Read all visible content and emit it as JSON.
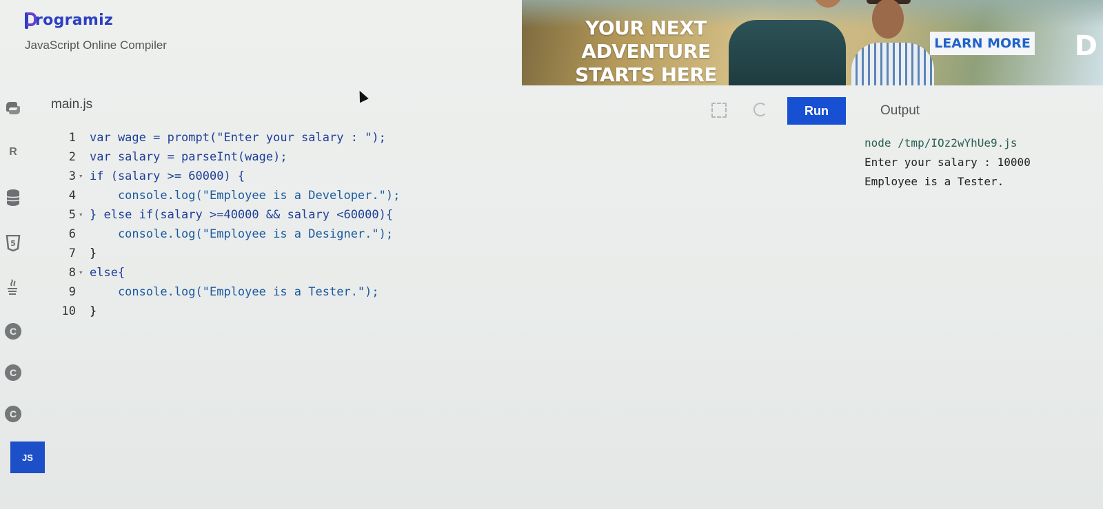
{
  "brand": {
    "logo_text": "rogramiz",
    "subtitle": "JavaScript Online Compiler"
  },
  "ad": {
    "headline_line1": "YOUR NEXT ADVENTURE",
    "headline_line2": "STARTS HERE",
    "cta_label": "LEARN MORE",
    "partial_text": "D"
  },
  "sidebar": {
    "icons": [
      "python-icon",
      "r-icon",
      "database-icon",
      "html5-icon",
      "java-icon",
      "c-icon",
      "cpp-icon",
      "csharp-icon"
    ],
    "c_glyph": "C",
    "r_glyph": "R",
    "html_glyph": "5",
    "active_label": "JS"
  },
  "editor": {
    "file_name": "main.js",
    "lines": [
      {
        "num": "1",
        "fold": "",
        "text": "var wage = prompt(\"Enter your salary : \");"
      },
      {
        "num": "2",
        "fold": "",
        "text": "var salary = parseInt(wage);"
      },
      {
        "num": "3",
        "fold": "▾",
        "text": "if (salary >= 60000) {"
      },
      {
        "num": "4",
        "fold": "",
        "text": "    console.log(\"Employee is a Developer.\");"
      },
      {
        "num": "5",
        "fold": "▾",
        "text": "} else if(salary >=40000 && salary <60000){"
      },
      {
        "num": "6",
        "fold": "",
        "text": "    console.log(\"Employee is a Designer.\");"
      },
      {
        "num": "7",
        "fold": "",
        "text": "}"
      },
      {
        "num": "8",
        "fold": "▾",
        "text": "else{"
      },
      {
        "num": "9",
        "fold": "",
        "text": "    console.log(\"Employee is a Tester.\");"
      },
      {
        "num": "10",
        "fold": "",
        "text": "}"
      }
    ]
  },
  "toolbar": {
    "run_label": "Run",
    "output_label": "Output"
  },
  "output": {
    "lines": [
      "node /tmp/IOz2wYhUe9.js",
      "Enter your salary : 10000",
      "Employee is a Tester."
    ]
  },
  "colors": {
    "accent": "#1750d3",
    "brand": "#2b3fc2"
  }
}
